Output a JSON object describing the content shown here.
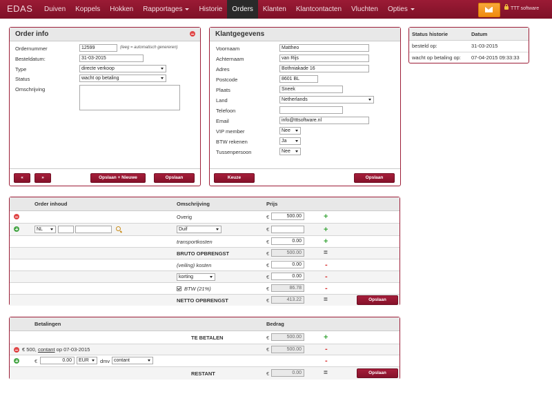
{
  "nav": {
    "brand": "EDAS",
    "items": [
      "Duiven",
      "Koppels",
      "Hokken",
      "Rapportages",
      "Historie",
      "Orders",
      "Klanten",
      "Klantcontacten",
      "Vluchten",
      "Opties"
    ],
    "active": "Orders",
    "user": "TTT software"
  },
  "order_info": {
    "title": "Order info",
    "ordernummer_label": "Ordernummer",
    "ordernummer_value": "12599",
    "ordernummer_hint": "(leeg = automatisch genereren)",
    "besteldatum_label": "Besteldatum:",
    "besteldatum_value": "31-03-2015",
    "type_label": "Type",
    "type_value": "directe verkoop",
    "status_label": "Status",
    "status_value": "wacht op betaling",
    "omschrijving_label": "Omschrijving",
    "btn_prev": "«",
    "btn_next": "»",
    "btn_save_new": "Opslaan + Nieuwe",
    "btn_save": "Opslaan"
  },
  "klant": {
    "title": "Klantgegevens",
    "fields": [
      {
        "label": "Voornaam",
        "value": "Mattheo"
      },
      {
        "label": "Achternaam",
        "value": "van Rijs"
      },
      {
        "label": "Adres",
        "value": "Bothniakade 16"
      },
      {
        "label": "Postcode",
        "value": "8601 BL"
      },
      {
        "label": "Plaats",
        "value": "Sneek"
      },
      {
        "label": "Land",
        "value": "Netherlands"
      },
      {
        "label": "Telefoon",
        "value": ""
      },
      {
        "label": "Email",
        "value": "info@tttsoftware.nl"
      },
      {
        "label": "VIP member",
        "value": "Nee"
      },
      {
        "label": "BTW rekenen",
        "value": "Ja"
      },
      {
        "label": "Tussenpersoon",
        "value": "Nee"
      }
    ],
    "btn_keuze": "Keuze",
    "btn_save": "Opslaan"
  },
  "status_historie": {
    "col1": "Status historie",
    "col2": "Datum",
    "rows": [
      {
        "status": "besteld op:",
        "datum": "31-03-2015"
      },
      {
        "status": "wacht op betaling op:",
        "datum": "07-04-2015 09:33:33"
      }
    ]
  },
  "order_table": {
    "col_inhoud": "Order inhoud",
    "col_omschrijving": "Omschrijving",
    "col_prijs": "Prijs",
    "currency": "€",
    "row_overig": {
      "omschrijving": "Overig",
      "prijs": "500.00"
    },
    "row_new": {
      "country": "NL",
      "product": "Duif"
    },
    "transport": {
      "label": "transportkosten",
      "prijs": "0.00"
    },
    "bruto": {
      "label": "BRUTO OPBRENGST",
      "prijs": "500.00"
    },
    "veiling": {
      "label": "(veiling) kosten",
      "prijs": "0.00"
    },
    "korting": {
      "label": "korting",
      "prijs": "0.00"
    },
    "btw": {
      "label": "BTW (21%)",
      "prijs": "86.78"
    },
    "netto": {
      "label": "NETTO OPBRENGST",
      "prijs": "413.22"
    },
    "btn_save": "Opslaan"
  },
  "payments": {
    "col_betalingen": "Betalingen",
    "col_bedrag": "Bedrag",
    "currency": "€",
    "te_betalen": {
      "label": "TE BETALEN",
      "value": "500.00"
    },
    "payment_row": {
      "text_pre": "€ 500,",
      "method": "contant",
      "text_post": "op 07-03-2015",
      "value": "500.00"
    },
    "new_row": {
      "amount": "0.00",
      "currency": "EUR",
      "dmv": "dmv",
      "method": "contant"
    },
    "restant": {
      "label": "RESTANT",
      "value": "0.00"
    },
    "btn_save": "Opslaan"
  },
  "colors": {
    "brand": "#9b1b35",
    "button": "#95172f",
    "accent": "#f08a0d"
  }
}
